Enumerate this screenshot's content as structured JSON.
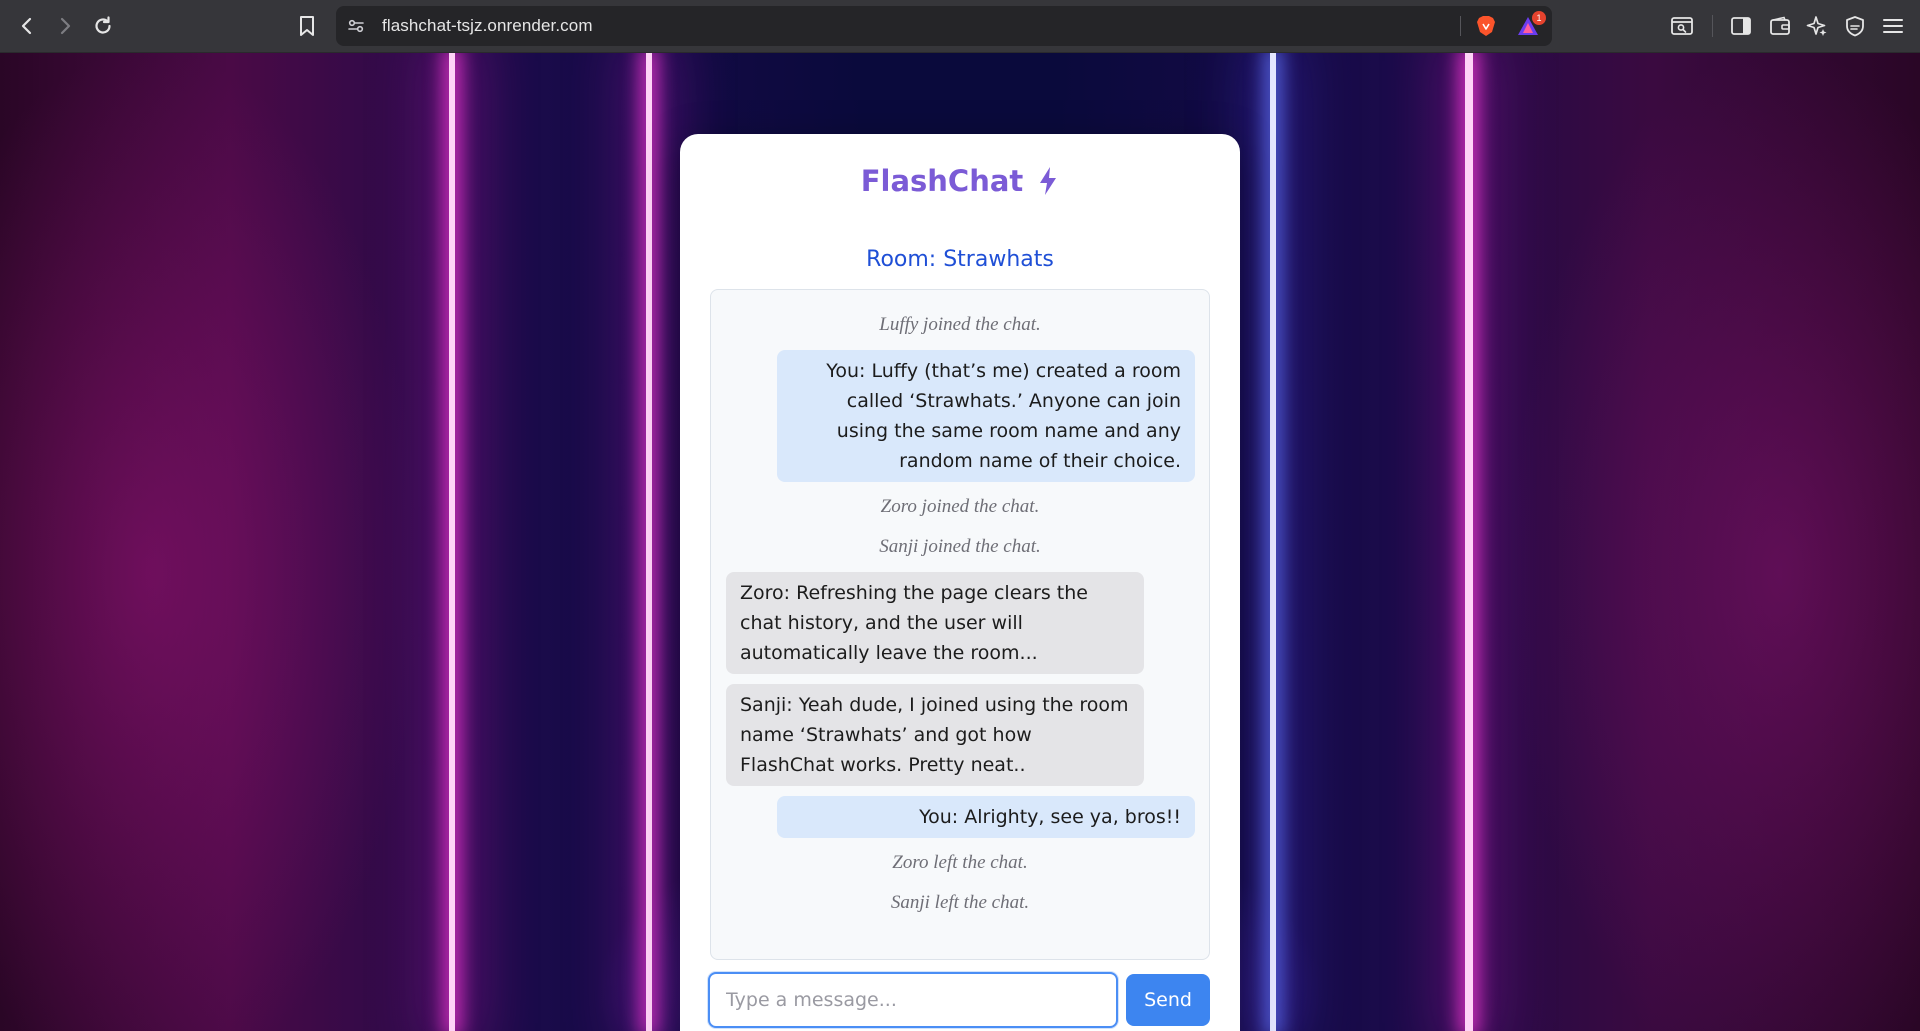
{
  "browser": {
    "url": "flashchat-tsjz.onrender.com",
    "rewards_badge": "1"
  },
  "app": {
    "title": "FlashChat",
    "accent_color": "#7b5bd6"
  },
  "room": {
    "prefix": "Room:",
    "name": "Strawhats",
    "color": "#1f4fd6"
  },
  "messages": [
    {
      "type": "system",
      "text": "Luffy joined the chat."
    },
    {
      "type": "mine",
      "text": "You: Luffy (that’s me) created a room called ‘Strawhats.’ Anyone can join using the same room name and any random name of their choice."
    },
    {
      "type": "system",
      "text": "Zoro joined the chat."
    },
    {
      "type": "system",
      "text": "Sanji joined the chat."
    },
    {
      "type": "theirs",
      "text": "Zoro: Refreshing the page clears the chat history, and the user will automatically leave the room..."
    },
    {
      "type": "theirs",
      "text": "Sanji: Yeah dude, I joined using the room name ‘Strawhats’ and got how FlashChat works. Pretty neat.."
    },
    {
      "type": "mine",
      "text": "You: Alrighty, see ya, bros!!"
    },
    {
      "type": "system",
      "text": "Zoro left the chat."
    },
    {
      "type": "system",
      "text": "Sanji left the chat."
    }
  ],
  "composer": {
    "placeholder": "Type a message...",
    "value": "",
    "send_label": "Send"
  }
}
